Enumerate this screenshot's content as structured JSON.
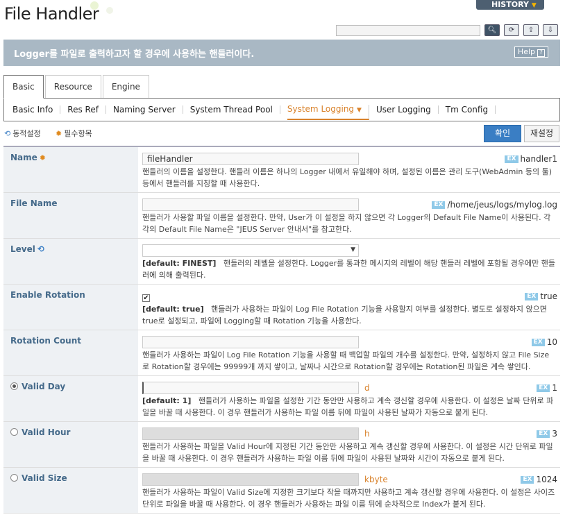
{
  "page": {
    "title": "File Handler"
  },
  "header": {
    "history_label": "HISTORY"
  },
  "banner": {
    "text": "Logger를 파일로 출력하고자 할 경우에 사용하는 핸들러이다.",
    "help_label": "Help"
  },
  "tabs": [
    {
      "label": "Basic",
      "active": true
    },
    {
      "label": "Resource"
    },
    {
      "label": "Engine"
    }
  ],
  "subnav": [
    {
      "label": "Basic Info"
    },
    {
      "label": "Res Ref"
    },
    {
      "label": "Naming Server"
    },
    {
      "label": "System Thread Pool"
    },
    {
      "label": "System Logging",
      "active": true
    },
    {
      "label": "User Logging"
    },
    {
      "label": "Tm Config"
    }
  ],
  "legend": {
    "dynamic": "동적설정",
    "required": "필수항목"
  },
  "buttons": {
    "confirm": "확인",
    "reset": "재설정"
  },
  "fields": {
    "name": {
      "label": "Name",
      "value": "fileHandler",
      "example": "handler1",
      "ex_badge": "EX",
      "desc": "핸들러의 이름을 설정한다. 핸들러 이름은 하나의 Logger 내에서 유일해야 하며, 설정된 이름은 관리 도구(WebAdmin 등의 툴) 등에서 핸들러를 지칭할 때 사용한다."
    },
    "file_name": {
      "label": "File Name",
      "value": "",
      "example": "/home/jeus/logs/mylog.log",
      "ex_badge": "EX",
      "desc": "핸들러가 사용할 파일 이름을 설정한다. 만약, User가 이 설정을 하지 않으면 각 Logger의 Default File Name이 사용된다. 각각의 Default File Name은 \"JEUS Server 안내서\"를 참고한다."
    },
    "level": {
      "label": "Level",
      "value": "",
      "default": "[default: FINEST]",
      "desc": "핸들러의 레벨을 설정한다. Logger를 통과한 메시지의 레벨이 해당 핸들러 레벨에 포함될 경우에만 핸들러에 의해 출력된다."
    },
    "enable_rotation": {
      "label": "Enable Rotation",
      "checked": true,
      "example": "true",
      "ex_badge": "EX",
      "default": "[default: true]",
      "desc": "핸들러가 사용하는 파일이 Log File Rotation 기능을 사용할지 여부를 설정한다. 별도로 설정하지 않으면 true로 설정되고, 파일에 Logging할 때 Rotation 기능을 사용한다."
    },
    "rotation_count": {
      "label": "Rotation Count",
      "value": "",
      "example": "10",
      "ex_badge": "EX",
      "desc": "핸들러가 사용하는 파일이 Log File Rotation 기능을 사용할 때 백업할 파일의 개수를 설정한다. 만약, 설정하지 않고 File Size로 Rotation할 경우에는 99999개 까지 쌓이고, 날짜나 시간으로 Rotation할 경우에는 Rotation된 파일은 계속 쌓인다."
    },
    "valid_day": {
      "label": "Valid Day",
      "selected": true,
      "value": "",
      "unit": "d",
      "example": "1",
      "ex_badge": "EX",
      "default": "[default: 1]",
      "desc": "핸들러가 사용하는 파일을 설정한 기간 동안만 사용하고 계속 갱신할 경우에 사용한다. 이 설정은 날짜 단위로 파일을 바꿀 때 사용한다. 이 경우 핸들러가 사용하는 파일 이름 뒤에 파일이 사용된 날짜가 자동으로 붙게 된다."
    },
    "valid_hour": {
      "label": "Valid Hour",
      "selected": false,
      "value": "",
      "unit": "h",
      "example": "3",
      "ex_badge": "EX",
      "desc": "핸들러가 사용하는 파일을 Valid Hour에 지정된 기간 동안만 사용하고 계속 갱신할 경우에 사용한다. 이 설정은 시간 단위로 파일을 바꿀 때 사용한다. 이 경우 핸들러가 사용하는 파일 이름 뒤에 파일이 사용된 날짜와 시간이 자동으로 붙게 된다."
    },
    "valid_size": {
      "label": "Valid Size",
      "selected": false,
      "value": "",
      "unit": "kbyte",
      "example": "1024",
      "ex_badge": "EX",
      "desc": "핸들러가 사용하는 파일이 Valid Size에 지정한 크기보다 작을 때까지만 사용하고 계속 갱신할 경우에 사용한다. 이 설정은 사이즈 단위로 파일을 바꿀 때 사용한다. 이 경우 핸들러가 사용하는 파일 이름 뒤에 순차적으로 Index가 붙게 된다."
    }
  },
  "colors": {
    "banner": "#a9b8c4",
    "accent_orange": "#d9822b",
    "label_blue": "#456a8a",
    "confirm_blue": "#3a7ec4"
  }
}
